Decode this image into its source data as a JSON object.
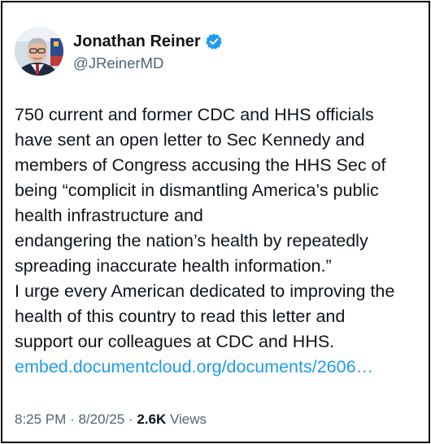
{
  "author": {
    "name": "Jonathan Reiner",
    "handle": "@JReinerMD",
    "verified_color": "#1d9bf0"
  },
  "tweet": {
    "lines": [
      "750 current and former CDC and HHS officials",
      "have sent an open letter to Sec Kennedy and",
      "members of Congress accusing the HHS Sec of",
      "being “complicit in dismantling America’s public",
      "health infrastructure and",
      "endangering the nation’s health by repeatedly",
      "spreading inaccurate health information.”",
      "I urge every American dedicated to improving the",
      "health of this country to read this letter and",
      "support our colleagues at CDC and HHS."
    ],
    "link": "embed.documentcloud.org/documents/2606…"
  },
  "meta": {
    "time": "8:25 PM",
    "separator": "·",
    "date": "8/20/25",
    "views_count": "2.6K",
    "views_label": "Views"
  },
  "icons": {
    "verified": "verified-badge-icon"
  }
}
